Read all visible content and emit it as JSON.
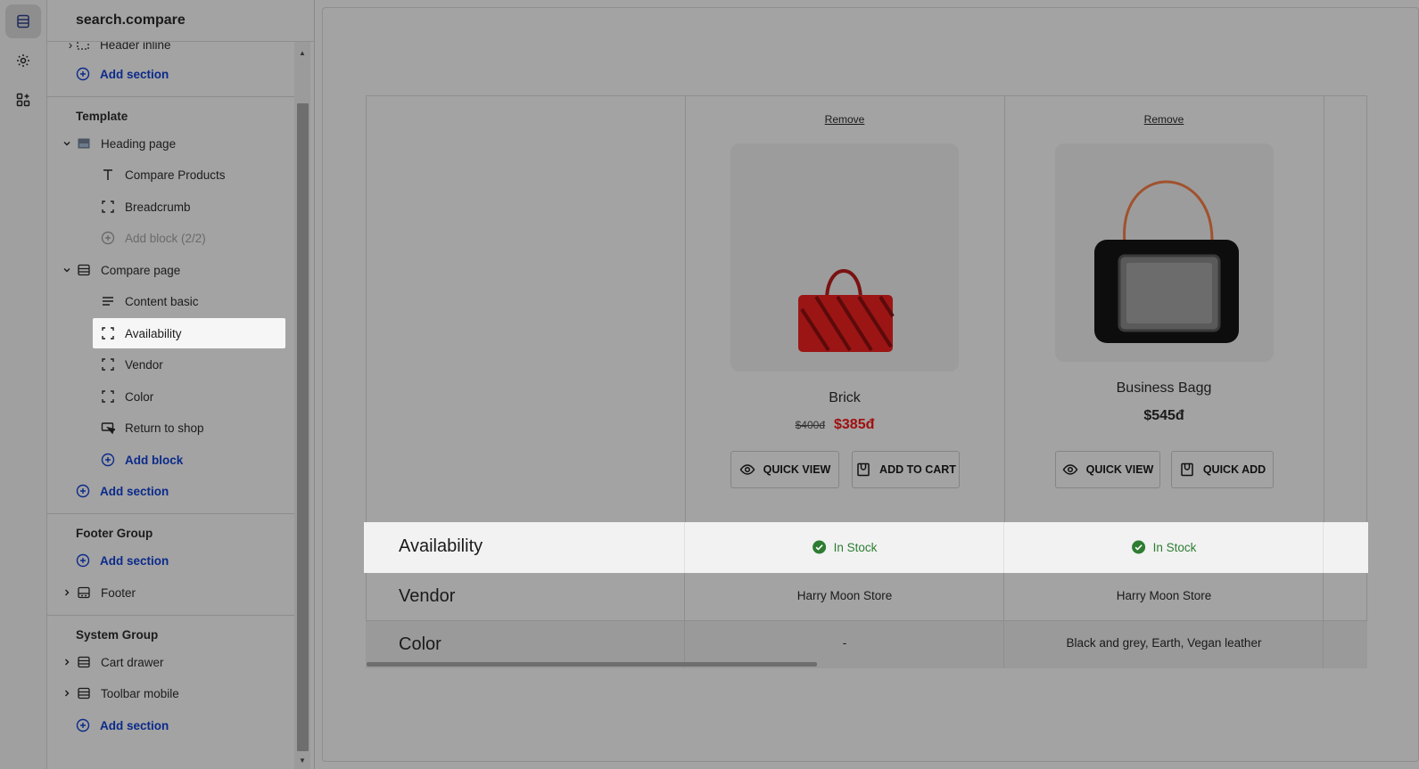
{
  "sidebar": {
    "title": "search.compare",
    "rail": [
      {
        "name": "sections-icon"
      },
      {
        "name": "settings-icon"
      },
      {
        "name": "apps-icon"
      }
    ],
    "top_partial_item": "Header inline",
    "add_section_label": "Add section",
    "template_group": "Template",
    "heading_page": "Heading page",
    "heading_blocks": [
      "Compare Products",
      "Breadcrumb"
    ],
    "heading_add_block": "Add block (2/2)",
    "compare_page": "Compare page",
    "compare_blocks": [
      "Content basic",
      "Availability",
      "Vendor",
      "Color",
      "Return to shop"
    ],
    "add_block_label": "Add block",
    "footer_group": "Footer Group",
    "footer_item": "Footer",
    "system_group": "System Group",
    "system_items": [
      "Cart drawer",
      "Toolbar mobile"
    ]
  },
  "compare": {
    "remove_label": "Remove",
    "products": [
      {
        "name": "Brick",
        "old_price": "$400đ",
        "price": "$385đ",
        "btn1": "QUICK VIEW",
        "btn2": "ADD TO CART"
      },
      {
        "name": "Business Bagg",
        "price": "$545đ",
        "btn1": "QUICK VIEW",
        "btn2": "QUICK ADD"
      }
    ],
    "rows": [
      {
        "label": "Availability",
        "values": [
          "In Stock",
          "In Stock"
        ]
      },
      {
        "label": "Vendor",
        "values": [
          "Harry Moon Store",
          "Harry Moon Store"
        ]
      },
      {
        "label": "Color",
        "values": [
          "-",
          "Black and grey, Earth, Vegan leather"
        ]
      }
    ],
    "colors": {
      "stock": "#2e7d32",
      "sale": "#a10f0f",
      "link": "#0b2a8a"
    }
  }
}
